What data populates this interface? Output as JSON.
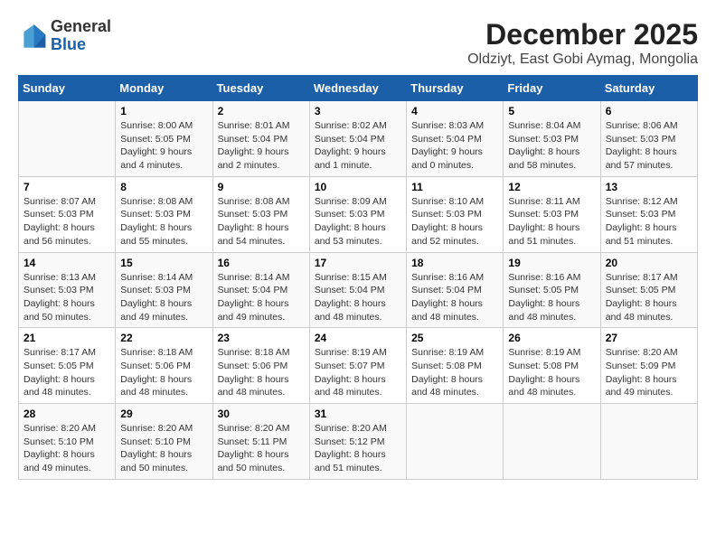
{
  "header": {
    "logo_general": "General",
    "logo_blue": "Blue",
    "title": "December 2025",
    "subtitle": "Oldziyt, East Gobi Aymag, Mongolia"
  },
  "days_of_week": [
    "Sunday",
    "Monday",
    "Tuesday",
    "Wednesday",
    "Thursday",
    "Friday",
    "Saturday"
  ],
  "weeks": [
    [
      {
        "num": "",
        "info": ""
      },
      {
        "num": "1",
        "info": "Sunrise: 8:00 AM\nSunset: 5:05 PM\nDaylight: 9 hours\nand 4 minutes."
      },
      {
        "num": "2",
        "info": "Sunrise: 8:01 AM\nSunset: 5:04 PM\nDaylight: 9 hours\nand 2 minutes."
      },
      {
        "num": "3",
        "info": "Sunrise: 8:02 AM\nSunset: 5:04 PM\nDaylight: 9 hours\nand 1 minute."
      },
      {
        "num": "4",
        "info": "Sunrise: 8:03 AM\nSunset: 5:04 PM\nDaylight: 9 hours\nand 0 minutes."
      },
      {
        "num": "5",
        "info": "Sunrise: 8:04 AM\nSunset: 5:03 PM\nDaylight: 8 hours\nand 58 minutes."
      },
      {
        "num": "6",
        "info": "Sunrise: 8:06 AM\nSunset: 5:03 PM\nDaylight: 8 hours\nand 57 minutes."
      }
    ],
    [
      {
        "num": "7",
        "info": "Sunrise: 8:07 AM\nSunset: 5:03 PM\nDaylight: 8 hours\nand 56 minutes."
      },
      {
        "num": "8",
        "info": "Sunrise: 8:08 AM\nSunset: 5:03 PM\nDaylight: 8 hours\nand 55 minutes."
      },
      {
        "num": "9",
        "info": "Sunrise: 8:08 AM\nSunset: 5:03 PM\nDaylight: 8 hours\nand 54 minutes."
      },
      {
        "num": "10",
        "info": "Sunrise: 8:09 AM\nSunset: 5:03 PM\nDaylight: 8 hours\nand 53 minutes."
      },
      {
        "num": "11",
        "info": "Sunrise: 8:10 AM\nSunset: 5:03 PM\nDaylight: 8 hours\nand 52 minutes."
      },
      {
        "num": "12",
        "info": "Sunrise: 8:11 AM\nSunset: 5:03 PM\nDaylight: 8 hours\nand 51 minutes."
      },
      {
        "num": "13",
        "info": "Sunrise: 8:12 AM\nSunset: 5:03 PM\nDaylight: 8 hours\nand 51 minutes."
      }
    ],
    [
      {
        "num": "14",
        "info": "Sunrise: 8:13 AM\nSunset: 5:03 PM\nDaylight: 8 hours\nand 50 minutes."
      },
      {
        "num": "15",
        "info": "Sunrise: 8:14 AM\nSunset: 5:03 PM\nDaylight: 8 hours\nand 49 minutes."
      },
      {
        "num": "16",
        "info": "Sunrise: 8:14 AM\nSunset: 5:04 PM\nDaylight: 8 hours\nand 49 minutes."
      },
      {
        "num": "17",
        "info": "Sunrise: 8:15 AM\nSunset: 5:04 PM\nDaylight: 8 hours\nand 48 minutes."
      },
      {
        "num": "18",
        "info": "Sunrise: 8:16 AM\nSunset: 5:04 PM\nDaylight: 8 hours\nand 48 minutes."
      },
      {
        "num": "19",
        "info": "Sunrise: 8:16 AM\nSunset: 5:05 PM\nDaylight: 8 hours\nand 48 minutes."
      },
      {
        "num": "20",
        "info": "Sunrise: 8:17 AM\nSunset: 5:05 PM\nDaylight: 8 hours\nand 48 minutes."
      }
    ],
    [
      {
        "num": "21",
        "info": "Sunrise: 8:17 AM\nSunset: 5:05 PM\nDaylight: 8 hours\nand 48 minutes."
      },
      {
        "num": "22",
        "info": "Sunrise: 8:18 AM\nSunset: 5:06 PM\nDaylight: 8 hours\nand 48 minutes."
      },
      {
        "num": "23",
        "info": "Sunrise: 8:18 AM\nSunset: 5:06 PM\nDaylight: 8 hours\nand 48 minutes."
      },
      {
        "num": "24",
        "info": "Sunrise: 8:19 AM\nSunset: 5:07 PM\nDaylight: 8 hours\nand 48 minutes."
      },
      {
        "num": "25",
        "info": "Sunrise: 8:19 AM\nSunset: 5:08 PM\nDaylight: 8 hours\nand 48 minutes."
      },
      {
        "num": "26",
        "info": "Sunrise: 8:19 AM\nSunset: 5:08 PM\nDaylight: 8 hours\nand 48 minutes."
      },
      {
        "num": "27",
        "info": "Sunrise: 8:20 AM\nSunset: 5:09 PM\nDaylight: 8 hours\nand 49 minutes."
      }
    ],
    [
      {
        "num": "28",
        "info": "Sunrise: 8:20 AM\nSunset: 5:10 PM\nDaylight: 8 hours\nand 49 minutes."
      },
      {
        "num": "29",
        "info": "Sunrise: 8:20 AM\nSunset: 5:10 PM\nDaylight: 8 hours\nand 50 minutes."
      },
      {
        "num": "30",
        "info": "Sunrise: 8:20 AM\nSunset: 5:11 PM\nDaylight: 8 hours\nand 50 minutes."
      },
      {
        "num": "31",
        "info": "Sunrise: 8:20 AM\nSunset: 5:12 PM\nDaylight: 8 hours\nand 51 minutes."
      },
      {
        "num": "",
        "info": ""
      },
      {
        "num": "",
        "info": ""
      },
      {
        "num": "",
        "info": ""
      }
    ]
  ]
}
